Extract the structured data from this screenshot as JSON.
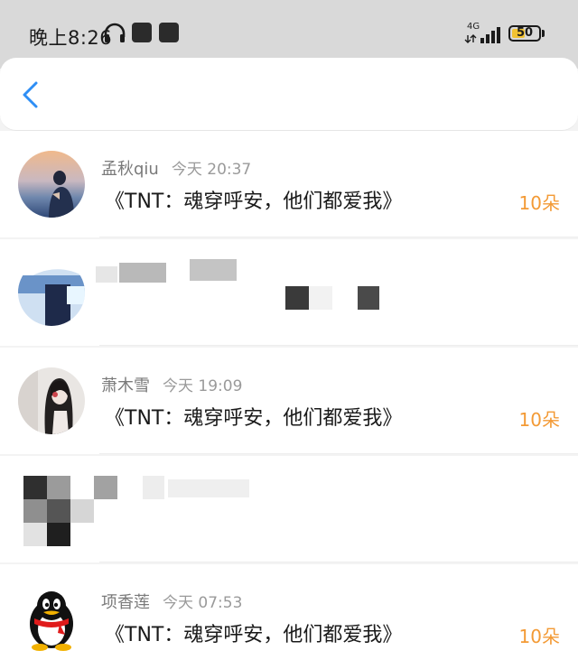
{
  "status_bar": {
    "time": "晚上8:26",
    "network": "4G",
    "battery": "50",
    "battery_percent": 50
  },
  "nav": {
    "back_icon": "chevron-left-icon"
  },
  "messages": [
    {
      "name": "孟秋qiu",
      "time": "今天 20:37",
      "text": "《TNT：魂穿呼安，他们都爱我》",
      "gift": "10朵",
      "avatar": "photo"
    },
    {
      "redacted": true
    },
    {
      "name": "萧木雪",
      "time": "今天 19:09",
      "text": "《TNT：魂穿呼安，他们都爱我》",
      "gift": "10朵",
      "avatar": "photo"
    },
    {
      "redacted": true
    },
    {
      "name": "项香莲",
      "time": "今天 07:53",
      "text": "《TNT：魂穿呼安，他们都爱我》",
      "gift": "10朵",
      "avatar": "qq-penguin"
    }
  ],
  "colors": {
    "gift": "#f39a35",
    "accent": "#2e8ef5",
    "status_bar_bg": "#d9d9d9"
  }
}
